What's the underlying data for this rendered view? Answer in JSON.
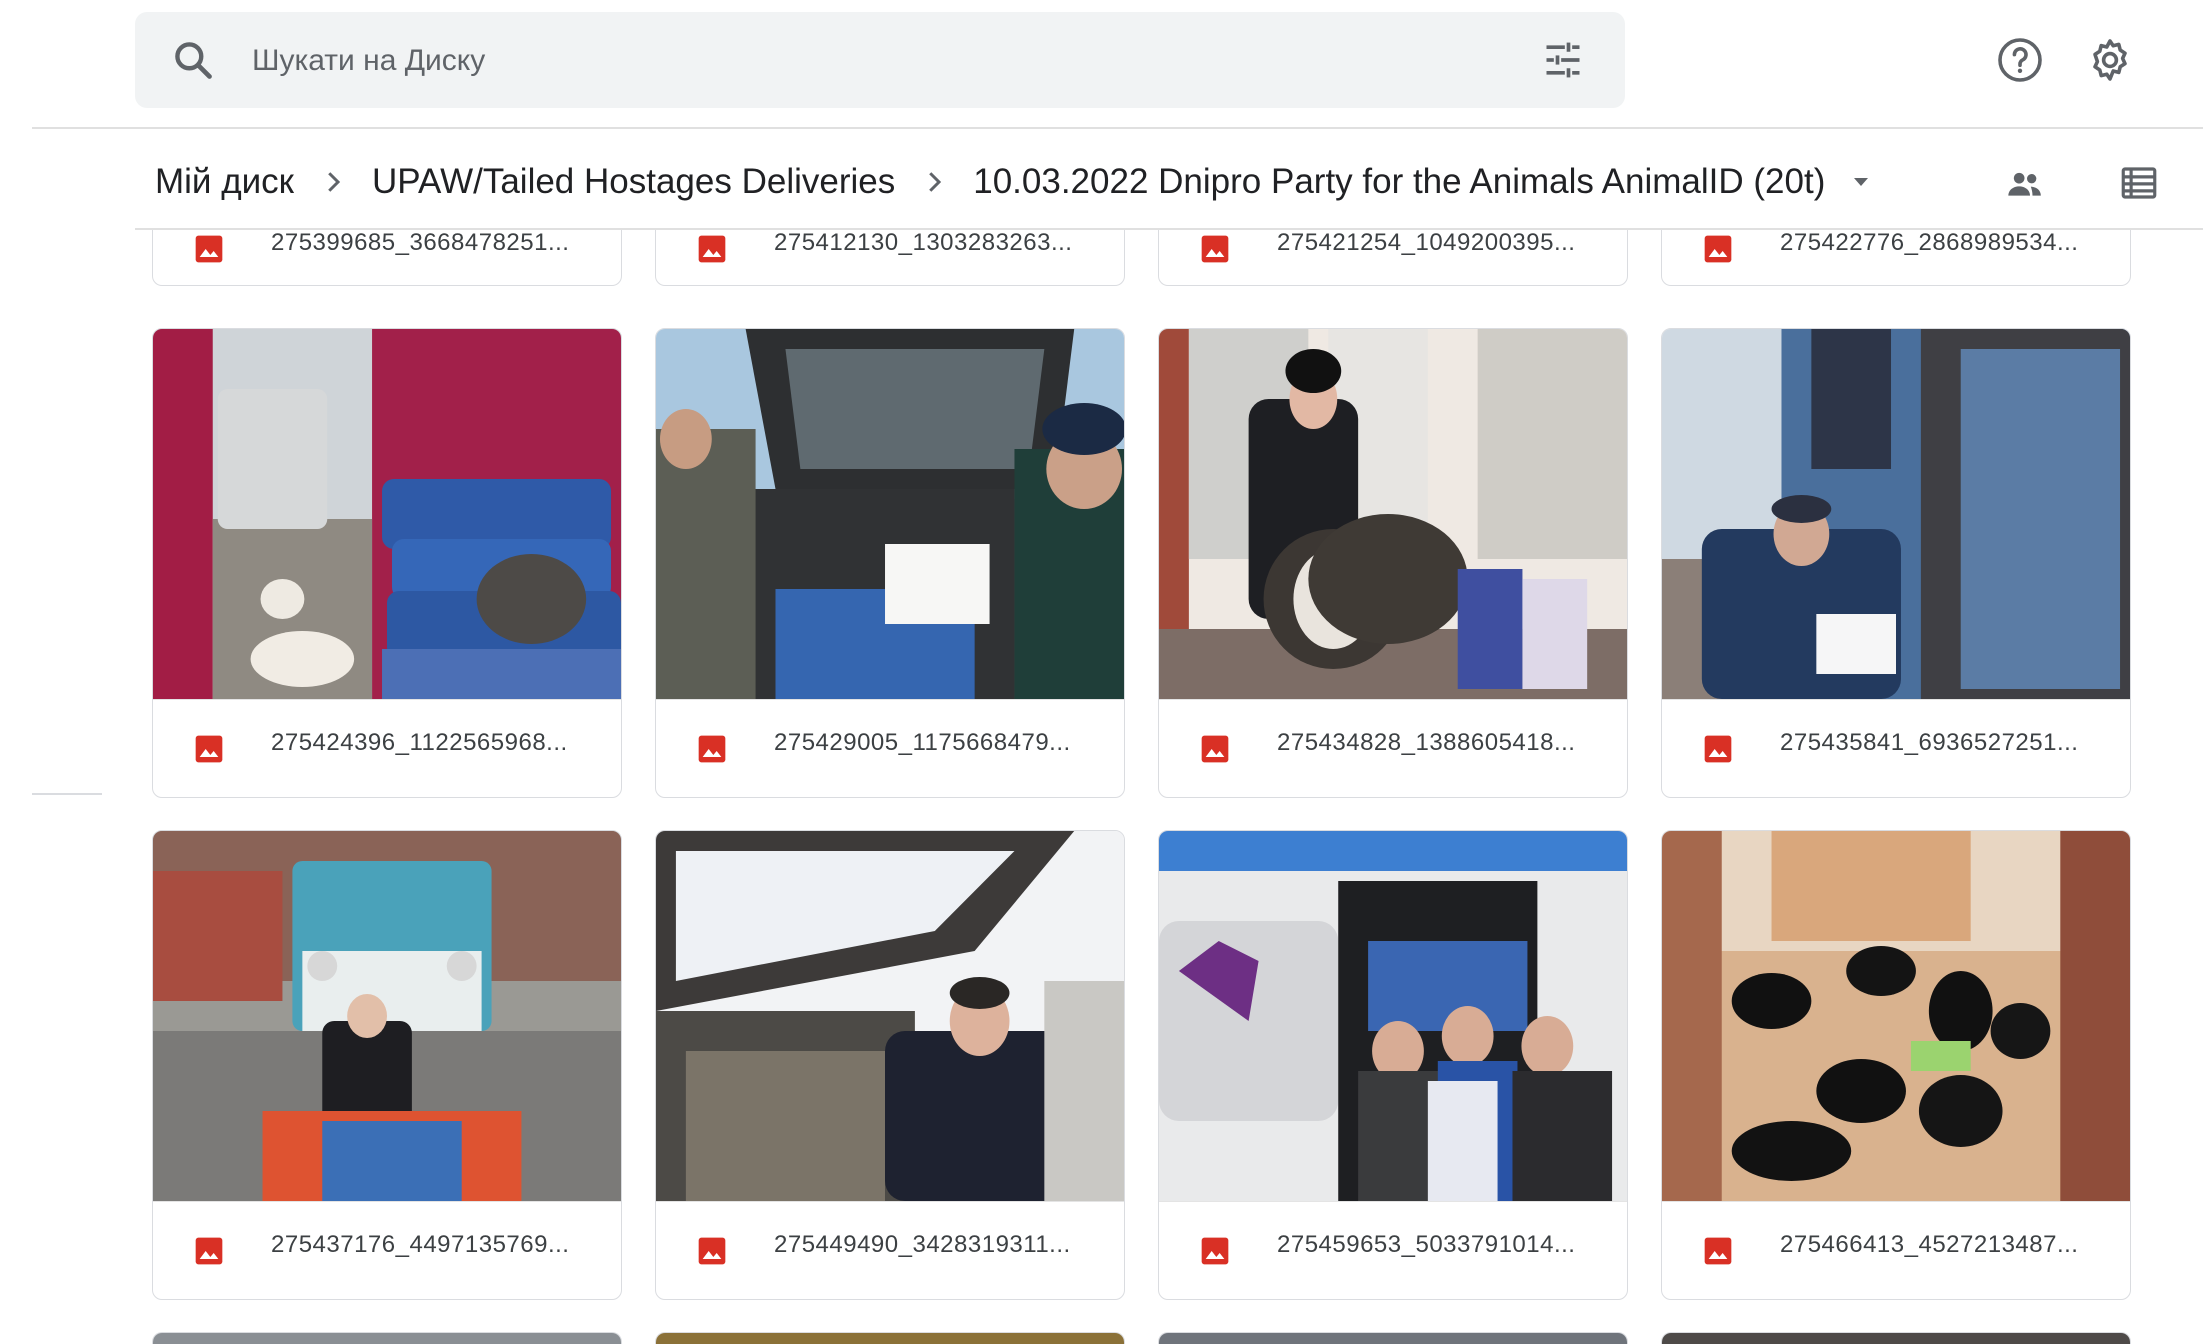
{
  "search": {
    "placeholder": "Шукати на Диску"
  },
  "breadcrumb": [
    "Мій диск",
    "UPAW/Tailed Hostages Deliveries",
    "10.03.2022 Dnipro Party for the Animals AnimalID (20t)"
  ],
  "icons": {
    "search": "search-icon",
    "tune": "tune-icon",
    "help": "help-icon",
    "settings": "gear-icon",
    "shared": "people-icon",
    "view": "list-view-icon",
    "file": "image-file-icon"
  },
  "colors": {
    "file_icon": "#d93025",
    "accent": "#1a73e8"
  },
  "files": {
    "row0": [
      "275399685_3668478251...",
      "275412130_1303283263...",
      "275421254_1049200395...",
      "275422776_2868989534..."
    ],
    "row1": [
      "275424396_1122565968...",
      "275429005_1175668479...",
      "275434828_1388605418...",
      "275435841_6936527251..."
    ],
    "row2": [
      "275437176_4497135769...",
      "275449490_3428319311...",
      "275459653_5033791014...",
      "275466413_4527213487..."
    ]
  }
}
